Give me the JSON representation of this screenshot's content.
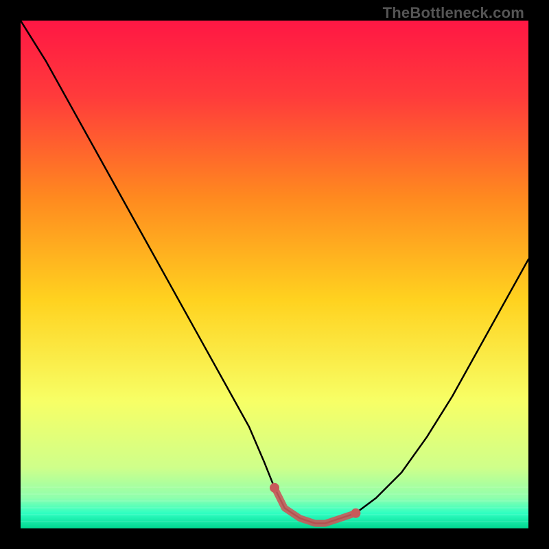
{
  "watermark": "TheBottleneck.com",
  "chart_data": {
    "type": "line",
    "title": "",
    "xlabel": "",
    "ylabel": "",
    "xlim": [
      0,
      100
    ],
    "ylim": [
      0,
      100
    ],
    "grid": false,
    "legend": false,
    "gradient_stops": [
      {
        "offset": 0.0,
        "color": "#ff1744"
      },
      {
        "offset": 0.15,
        "color": "#ff3b3b"
      },
      {
        "offset": 0.35,
        "color": "#ff8a1f"
      },
      {
        "offset": 0.55,
        "color": "#ffd21f"
      },
      {
        "offset": 0.75,
        "color": "#f7ff66"
      },
      {
        "offset": 0.88,
        "color": "#cfff8a"
      },
      {
        "offset": 0.94,
        "color": "#8fffad"
      },
      {
        "offset": 0.97,
        "color": "#2fffc2"
      },
      {
        "offset": 1.0,
        "color": "#00d68f"
      }
    ],
    "series": [
      {
        "name": "bottleneck-curve",
        "x": [
          0,
          5,
          10,
          15,
          20,
          25,
          30,
          35,
          40,
          45,
          48,
          50,
          52,
          55,
          58,
          60,
          63,
          66,
          70,
          75,
          80,
          85,
          90,
          95,
          100
        ],
        "y": [
          100,
          92,
          83,
          74,
          65,
          56,
          47,
          38,
          29,
          20,
          13,
          8,
          4,
          2,
          1,
          1,
          2,
          3,
          6,
          11,
          18,
          26,
          35,
          44,
          53
        ]
      }
    ],
    "highlight_segment": {
      "name": "optimal-zone",
      "color": "#c85a5a",
      "x": [
        50,
        52,
        55,
        58,
        60,
        63,
        66
      ],
      "y": [
        8,
        4,
        2,
        1,
        1,
        2,
        3
      ]
    }
  }
}
